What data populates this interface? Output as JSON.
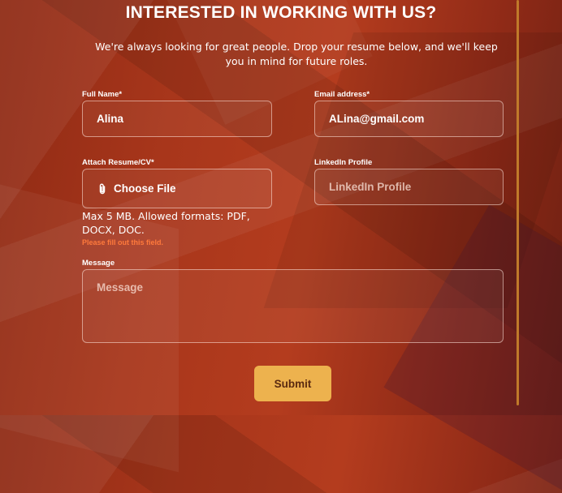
{
  "page": {
    "title": "INTERESTED IN WORKING WITH US?",
    "subtitle": "We're always looking for great people. Drop your resume below, and we'll keep you in mind for future roles."
  },
  "form": {
    "full_name": {
      "label": "Full Name*",
      "value": "Alina"
    },
    "email": {
      "label": "Email address*",
      "value": "ALina@gmail.com"
    },
    "resume": {
      "label": "Attach Resume/CV*",
      "button_label": "Choose File",
      "hint": "Max 5 MB. Allowed formats: PDF, DOCX, DOC.",
      "error": "Please fill out this field."
    },
    "linkedin": {
      "label": "LinkedIn Profile",
      "placeholder": "LinkedIn Profile"
    },
    "message": {
      "label": "Message",
      "placeholder": "Message"
    },
    "submit_label": "Submit"
  },
  "colors": {
    "background": "#a8361b",
    "accent_button": "#edb24e",
    "error_text": "#ff7a3c",
    "scrollbar": "#c07a2a"
  },
  "icons": {
    "attach": "paperclip-icon"
  }
}
